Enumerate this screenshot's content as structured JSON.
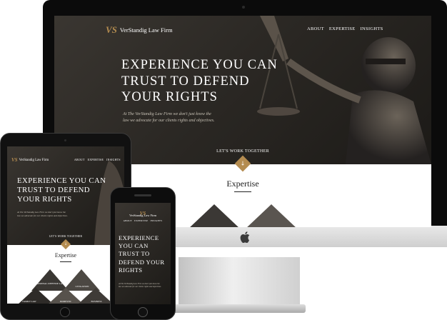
{
  "site": {
    "brand": "VerStandig Law Firm",
    "logo_mark": "VS",
    "nav": [
      "ABOUT",
      "EXPERTISE",
      "INSIGHTS"
    ],
    "hero_title_lines": [
      "EXPERIENCE YOU CAN",
      "TRUST TO DEFEND",
      "YOUR RIGHTS"
    ],
    "hero_subtitle_lines": [
      "At The VerStandig Law Firm we don't just know the",
      "law we advocate for our clients rights and objectives."
    ],
    "cta": "LET'S WORK TOGETHER",
    "cta_arrow": "↓",
    "section_title": "Expertise"
  },
  "tablet": {
    "nav": [
      "ABOUT",
      "EXPERTISE",
      "INSIGHTS"
    ],
    "hero_title_lines": [
      "EXPERIENCE YOU CAN",
      "TRUST TO DEFEND",
      "YOUR RIGHTS"
    ],
    "expertise_items": [
      "CRIMINAL DEFENSE LAW",
      "LITIGATION",
      "FAMILY LAW",
      "DOMESTIC",
      "BUSINESS"
    ]
  },
  "phone": {
    "hero_title_lines": [
      "EXPERIENCE",
      "YOU CAN",
      "TRUST TO",
      "DEFEND YOUR",
      "RIGHTS"
    ]
  },
  "colors": {
    "accent": "#b48c50",
    "hero_dark": "#2b2824",
    "device_black": "#0b0b0b"
  }
}
